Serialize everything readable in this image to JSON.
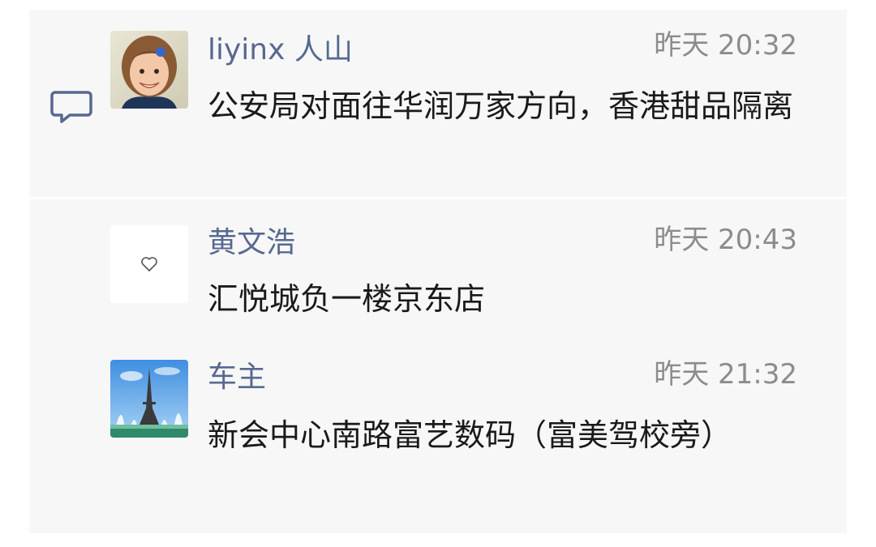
{
  "comments": [
    {
      "avatar": "child-photo-avatar",
      "name": "liyinx 人山",
      "time": "昨天 20:32",
      "text": "公安局对面往华润万家方向，香港甜品隔离"
    },
    {
      "avatar": "heart-icon",
      "name": "黄文浩",
      "time": "昨天 20:43",
      "text": "汇悦城负一楼京东店"
    },
    {
      "avatar": "eiffel-tower-photo-avatar",
      "name": "车主",
      "time": "昨天 21:32",
      "text": "新会中心南路富艺数码（富美驾校旁）"
    }
  ],
  "colors": {
    "name": "#57698f",
    "time": "#8c8c8c",
    "text": "#1a1a1a",
    "panel": "#f7f7f7"
  },
  "icons": {
    "comment": "speech-bubble-icon"
  }
}
